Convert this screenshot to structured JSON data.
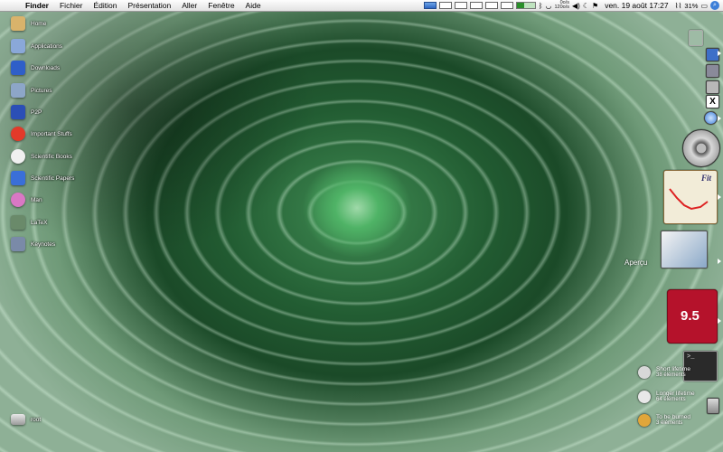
{
  "menubar": {
    "app_name": "Finder",
    "menus": [
      "Fichier",
      "Édition",
      "Présentation",
      "Aller",
      "Fenêtre",
      "Aide"
    ],
    "net_up": "0o/s",
    "net_down": "120o/s",
    "clock": "ven. 19 août 17:27",
    "battery": "31%"
  },
  "desktop_icons": [
    {
      "label": "Home",
      "icon": "home-icon",
      "color": "#d9b36b"
    },
    {
      "label": "Applications",
      "icon": "applications-icon",
      "color": "#8aa8d8"
    },
    {
      "label": "Downloads",
      "icon": "downloads-icon",
      "color": "#2f5fc8"
    },
    {
      "label": "Pictures",
      "icon": "pictures-icon",
      "color": "#8da6c8"
    },
    {
      "label": "P2P",
      "icon": "p2p-icon",
      "color": "#2b4fb6"
    },
    {
      "label": "Important Stuffs",
      "icon": "important-icon",
      "color": "#e23a2a"
    },
    {
      "label": "Scientific Books",
      "icon": "books-icon",
      "color": "#f0f0f0"
    },
    {
      "label": "Scientific Papers",
      "icon": "papers-icon",
      "color": "#3a6fd8"
    },
    {
      "label": "Man",
      "icon": "man-icon",
      "color": "#d978c4"
    },
    {
      "label": "LaTeX",
      "icon": "latex-icon",
      "color": "#6a8a6a"
    },
    {
      "label": "Keynotes",
      "icon": "keynotes-icon",
      "color": "#7a8aa8"
    }
  ],
  "hard_drive": {
    "label": "root",
    "icon": "hard-drive-icon"
  },
  "dock_right": {
    "preview_label": "Aperçu",
    "badge_label": "9.5",
    "fit_label": "Fit"
  },
  "stacks": [
    {
      "title": "Short lifetime",
      "count": "38 éléments",
      "icon": "short-lifetime-icon",
      "color": "#d8d8d8"
    },
    {
      "title": "Longer lifetime",
      "count": "64 éléments",
      "icon": "longer-lifetime-icon",
      "color": "#e8e8e8"
    },
    {
      "title": "To be burned",
      "count": "3 éléments",
      "icon": "to-be-burned-icon",
      "color": "#e0a63a"
    }
  ],
  "colors": {
    "menubar_bg": "#f0f0f0",
    "wallpaper_green": "#2a6a3a",
    "badge_red": "#b5122b"
  }
}
